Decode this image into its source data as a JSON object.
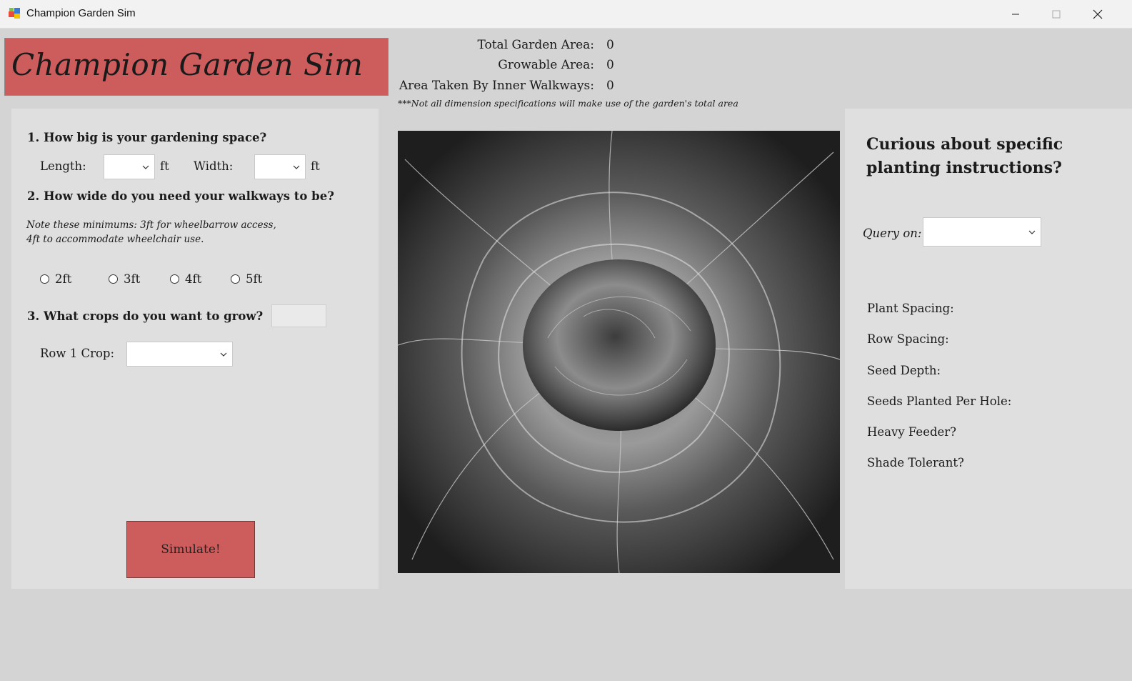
{
  "window": {
    "title": "Champion Garden Sim",
    "controls": [
      "minimize",
      "maximize",
      "close"
    ]
  },
  "header": {
    "banner_text": "Champion Garden Sim",
    "accent_color": "#cd5c5c"
  },
  "stats": {
    "total_area_label": "Total Garden Area:",
    "total_area_value": "0",
    "growable_area_label": "Growable Area:",
    "growable_area_value": "0",
    "walkway_area_label": "Area Taken By Inner Walkways:",
    "walkway_area_value": "0",
    "footnote": "***Not all dimension specifications will make use of the garden's total area"
  },
  "form": {
    "q1": "1. How big is your gardening space?",
    "length_label": "Length:",
    "length_value": "",
    "length_unit": "ft",
    "width_label": "Width:",
    "width_value": "",
    "width_unit": "ft",
    "q2": "2. How wide do you need your walkways to be?",
    "note_line1": "Note these minimums: 3ft for wheelbarrow access,",
    "note_line2": "4ft to accommodate wheelchair use.",
    "walkway_options": [
      "2ft",
      "3ft",
      "4ft",
      "5ft"
    ],
    "q3": "3. What crops do you want to grow?",
    "crop_count_value": "",
    "row1_label": "Row 1 Crop:",
    "row1_value": "",
    "simulate_label": "Simulate!"
  },
  "image": {
    "subject": "cabbage-photo"
  },
  "info": {
    "heading": "Curious about specific planting instructions?",
    "query_label": "Query on:",
    "query_value": "",
    "plant_spacing_label": "Plant Spacing:",
    "row_spacing_label": "Row Spacing:",
    "seed_depth_label": "Seed Depth:",
    "seeds_per_hole_label": "Seeds Planted Per Hole:",
    "heavy_feeder_label": "Heavy Feeder?",
    "shade_tolerant_label": "Shade Tolerant?"
  }
}
